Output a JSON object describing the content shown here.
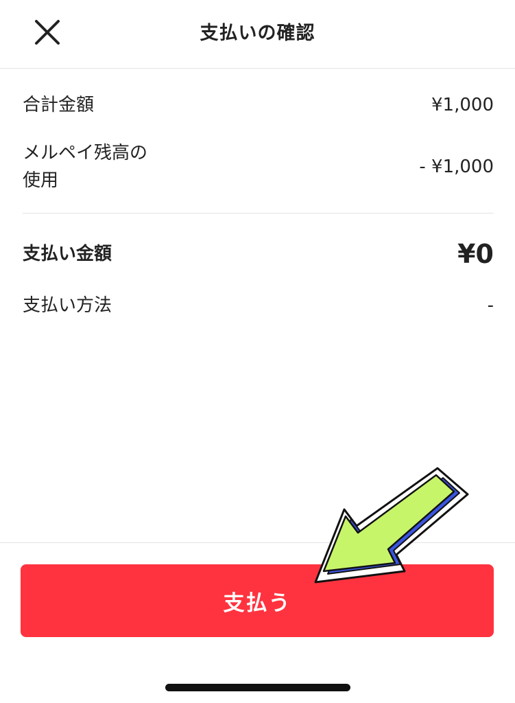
{
  "header": {
    "title": "支払いの確認",
    "close_icon": "close-icon"
  },
  "summary": {
    "total_label": "合計金額",
    "total_value": "¥1,000",
    "balance_label_line1": "メルペイ残高の",
    "balance_label_line2": "使用",
    "balance_value": "- ¥1,000",
    "pay_amount_label": "支払い金額",
    "pay_amount_value": "¥0",
    "method_label": "支払い方法",
    "method_value": "-"
  },
  "pay_button": {
    "label": "支払う"
  },
  "colors": {
    "accent": "#ff333f",
    "arrow_fill": "#c7f56a",
    "arrow_shadow": "#3a55e0"
  }
}
